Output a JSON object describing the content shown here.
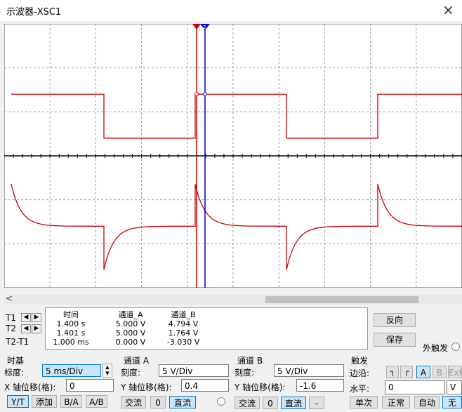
{
  "window": {
    "title": "示波器-XSC1",
    "close_label": "×"
  },
  "scrollbar": {
    "left_arrow": "<"
  },
  "cursors": {
    "t1_label": "T1",
    "t2_label": "T2",
    "diff_label": "T2-T1",
    "left_arrow": "◀",
    "right_arrow": "▶",
    "t1_marker": "1",
    "t2_marker": "2"
  },
  "readout": {
    "headers": [
      "时间",
      "通道_A",
      "通道_B"
    ],
    "rows": [
      [
        "1.400 s",
        "5.000 V",
        "4.794 V"
      ],
      [
        "1.401 s",
        "5.000 V",
        "1.764 V"
      ],
      [
        "1.000 ms",
        "0.000 V",
        "-3.030 V"
      ]
    ]
  },
  "side_buttons": {
    "reverse": "反向",
    "save": "保存",
    "ext_trigger": "外触发"
  },
  "timebase": {
    "title": "时基",
    "scale_label": "标度:",
    "scale_value": "5 ms/Div",
    "xpos_label": "X 轴位移(格):",
    "xpos_value": "0",
    "modes": [
      "Y/T",
      "添加",
      "B/A",
      "A/B"
    ],
    "active_mode": "Y/T"
  },
  "channel_a": {
    "title": "通道 A",
    "scale_label": "刻度:",
    "scale_value": "5  V/Div",
    "ypos_label": "Y 轴位移(格):",
    "ypos_value": "0.4",
    "coupling": [
      "交流",
      "0",
      "直流"
    ],
    "active_coupling": "直流"
  },
  "channel_b": {
    "title": "通道 B",
    "scale_label": "刻度:",
    "scale_value": "5  V/Div",
    "ypos_label": "Y 轴位移(格):",
    "ypos_value": "-1.6",
    "coupling": [
      "交流",
      "0",
      "直流"
    ],
    "active_coupling": "直流",
    "minus_label": "-"
  },
  "trigger": {
    "title": "触发",
    "edge_label": "边沿:",
    "edge_buttons": [
      "A",
      "B",
      "Ext"
    ],
    "level_label": "水平:",
    "level_value": "0",
    "level_unit": "V",
    "modes": [
      "单次",
      "正常",
      "自动",
      "无"
    ],
    "active_mode": "无"
  },
  "colors": {
    "screen_bg": "#ffffff",
    "trace": "#cc0000",
    "cursor": "#cc0000",
    "cursor2": "#0000cc",
    "grid": "#9a9a9a"
  },
  "chart_data": {
    "type": "line",
    "divisions": {
      "x": 10,
      "y": 6
    },
    "cursor_t1_s": 1.4,
    "cursor_t2_s": 1.401,
    "series": [
      {
        "channel": "A",
        "shape": "square",
        "high_div": 1.4,
        "low_div": 0.4,
        "half_period_div": 2.0
      },
      {
        "channel": "B",
        "shape": "rc-differentiator",
        "rest_div": -1.6,
        "spike_div": 1.0
      }
    ]
  }
}
